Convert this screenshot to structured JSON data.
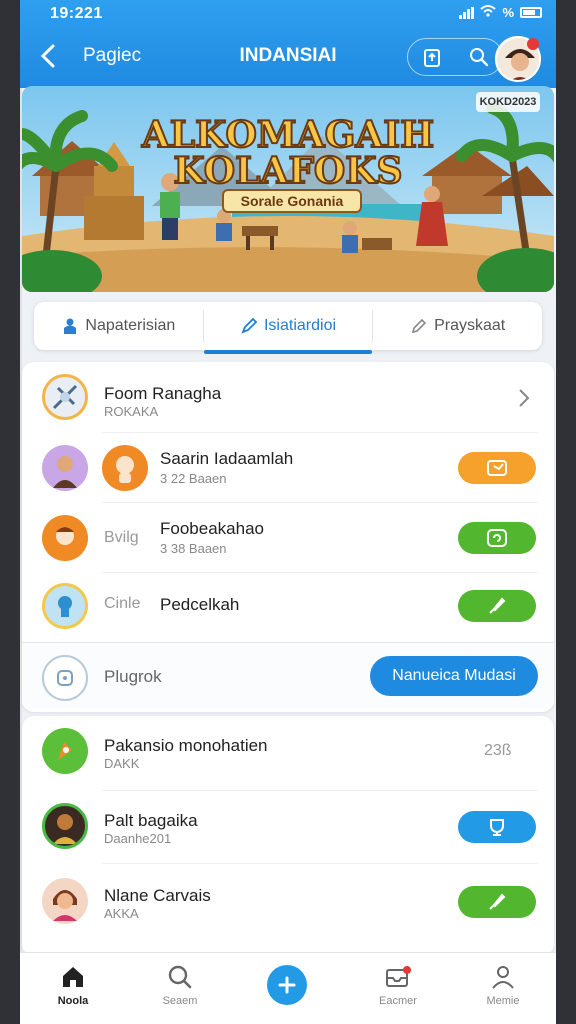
{
  "status": {
    "time": "19:221",
    "battery": "%"
  },
  "header": {
    "back_label": "Pagiec",
    "title": "INDANSIAI"
  },
  "banner": {
    "badge": "KOKD2023",
    "title_line1": "ALKOMAGAIH",
    "title_line2": "KOLAFOKS",
    "subtitle": "Sorale Gonania"
  },
  "tabs": [
    {
      "label": "Napaterisian",
      "icon": "person-icon"
    },
    {
      "label": "Isiatiardioi",
      "icon": "pen-icon"
    },
    {
      "label": "Prayskaat",
      "icon": "pencil-icon"
    }
  ],
  "list1": [
    {
      "name": "Foom Ranagha",
      "sub": "ROKAKA",
      "action": "chevron"
    },
    {
      "name": "Saarin Iadaamlah",
      "sub": "3 22 Baaen",
      "action": "orange"
    },
    {
      "name": "Foobeakahao",
      "prefix": "Bvilg",
      "sub": "3 38 Baaen",
      "action": "green"
    },
    {
      "name": "Pedcelkah",
      "prefix": "Cinle",
      "sub": "",
      "action": "green"
    }
  ],
  "plugrok": {
    "label": "Plugrok",
    "button": "Nanueica Mudasi"
  },
  "list2": [
    {
      "name": "Pakansio monohatien",
      "sub": "DAKK",
      "value": "23ß"
    },
    {
      "name": "Palt bagaika",
      "sub": "Daanhe201",
      "action": "blue"
    },
    {
      "name": "Nlane Carvais",
      "sub": "AKKA",
      "action": "green"
    }
  ],
  "nav": [
    {
      "label": "Noola",
      "icon": "home-icon"
    },
    {
      "label": "Seaem",
      "icon": "search-icon"
    },
    {
      "label": "",
      "icon": "plus-icon"
    },
    {
      "label": "Eacmer",
      "icon": "inbox-icon"
    },
    {
      "label": "Memie",
      "icon": "profile-icon"
    }
  ]
}
